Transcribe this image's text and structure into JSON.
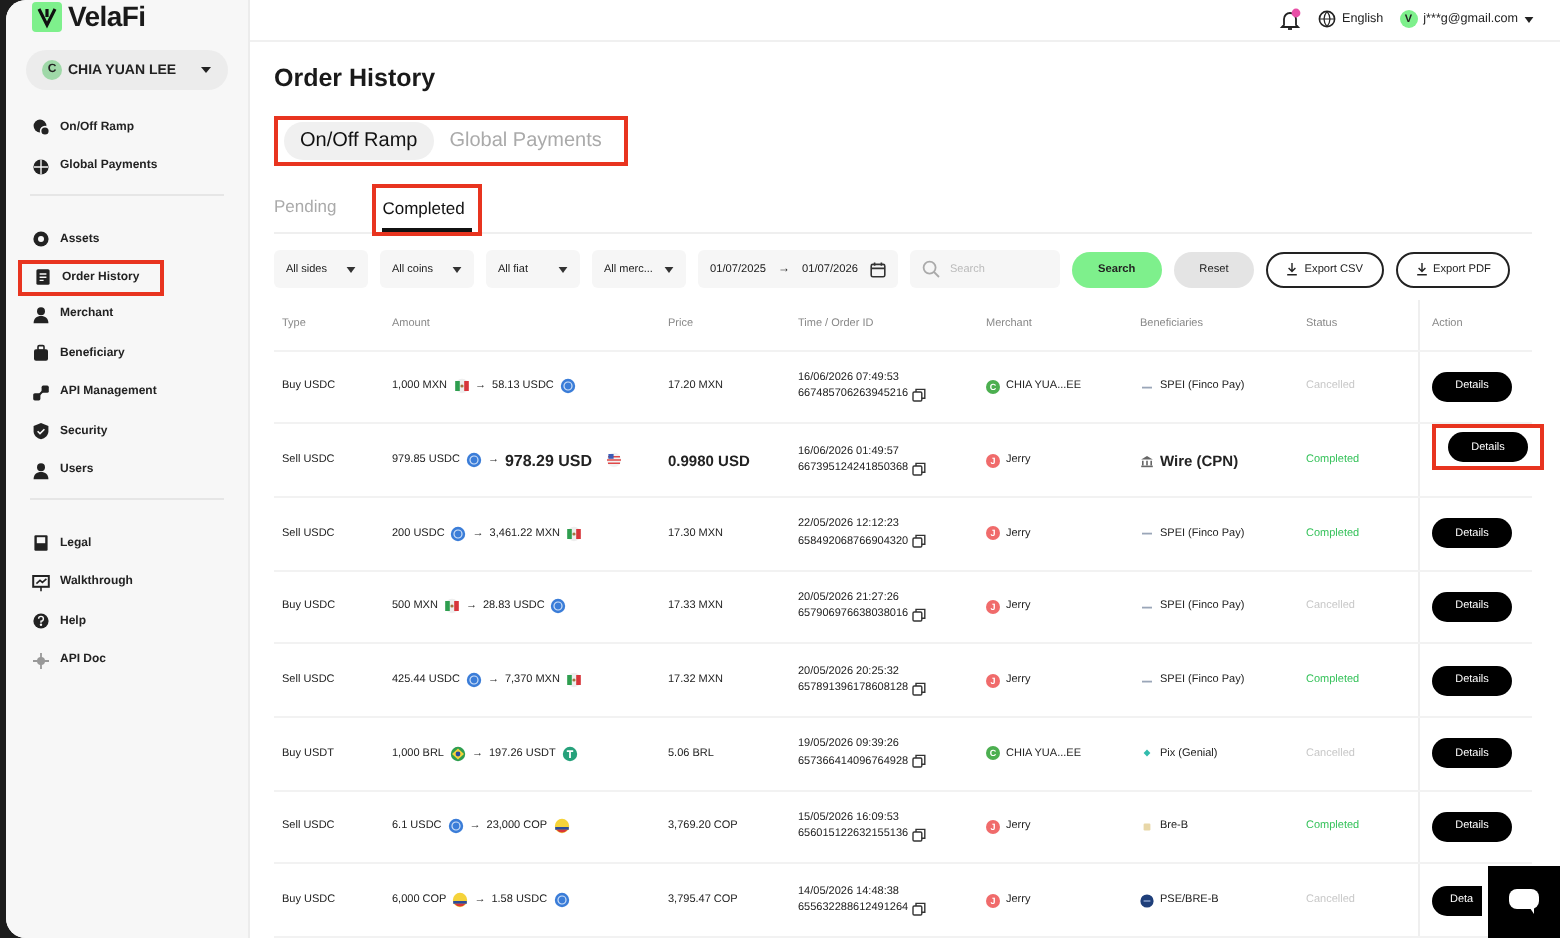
{
  "brand": {
    "name": "VelaFi"
  },
  "account": {
    "avatar": "C",
    "name": "CHIA YUAN LEE"
  },
  "sidebar": {
    "groups": [
      [
        {
          "label": "On/Off Ramp",
          "highlighted": false
        },
        {
          "label": "Global Payments",
          "highlighted": false
        }
      ],
      [
        {
          "label": "Assets",
          "highlighted": false
        },
        {
          "label": "Order History",
          "highlighted": true
        },
        {
          "label": "Merchant",
          "highlighted": false
        },
        {
          "label": "Beneficiary",
          "highlighted": false
        },
        {
          "label": "API Management",
          "highlighted": false
        },
        {
          "label": "Security",
          "highlighted": false
        },
        {
          "label": "Users",
          "highlighted": false
        }
      ],
      [
        {
          "label": "Legal",
          "highlighted": false
        },
        {
          "label": "Walkthrough",
          "highlighted": false
        },
        {
          "label": "Help",
          "highlighted": false
        },
        {
          "label": "API Doc",
          "highlighted": false
        }
      ]
    ]
  },
  "topbar": {
    "language": "English",
    "user_avatar": "V",
    "user_email": "j***g@gmail.com"
  },
  "page_title": "Order History",
  "ramp_tabs": {
    "highlighted": true,
    "items": [
      {
        "label": "On/Off Ramp",
        "selected": true
      },
      {
        "label": "Global Payments",
        "selected": false
      }
    ]
  },
  "status_tabs": [
    {
      "label": "Pending",
      "selected": false,
      "highlighted": false
    },
    {
      "label": "Completed",
      "selected": true,
      "highlighted": true
    }
  ],
  "filters": {
    "dropdowns": [
      "All sides",
      "All coins",
      "All fiat",
      "All merc..."
    ],
    "date_from": "01/07/2025",
    "date_arrow": "→",
    "date_to": "01/07/2026",
    "search_placeholder": "Search",
    "buttons": [
      {
        "label": "Search",
        "kind": "primary"
      },
      {
        "label": "Reset",
        "kind": "secondary"
      },
      {
        "label": "Export CSV",
        "kind": "export"
      },
      {
        "label": "Export PDF",
        "kind": "export"
      }
    ]
  },
  "table": {
    "columns": [
      "Type",
      "Amount",
      "Price",
      "Time / Order ID",
      "Merchant",
      "Beneficiaries",
      "Status",
      "Action"
    ],
    "rows": [
      {
        "type": "Buy USDC",
        "from": {
          "text": "1,000 MXN",
          "kind": "mx"
        },
        "arrow": "→",
        "to": {
          "text": "58.13 USDC",
          "kind": "usdc"
        },
        "emphasis": false,
        "price": "17.20 MXN",
        "time": "16/06/2026 07:49:53",
        "order_id": "667485706263945216",
        "merchant": {
          "avatar": "C",
          "name": "CHIA YUA...EE",
          "color": "#4caf50"
        },
        "beneficiary": {
          "text": "SPEI (Finco Pay)",
          "kind": "spei"
        },
        "status": {
          "text": "Cancelled",
          "kind": "cancelled"
        },
        "action": "Details",
        "highlighted": false
      },
      {
        "type": "Sell USDC",
        "from": {
          "text": "979.85 USDC",
          "kind": "usdc"
        },
        "arrow": "→",
        "to": {
          "text": "978.29 USD",
          "kind": "us"
        },
        "emphasis": true,
        "price": "0.9980 USD",
        "time": "16/06/2026 01:49:57",
        "order_id": "667395124241850368",
        "merchant": {
          "avatar": "J",
          "name": "Jerry",
          "color": "#f06b6b"
        },
        "beneficiary": {
          "text": "Wire (CPN)",
          "kind": "bank"
        },
        "status": {
          "text": "Completed",
          "kind": "completed"
        },
        "action": "Details",
        "highlighted": true
      },
      {
        "type": "Sell USDC",
        "from": {
          "text": "200 USDC",
          "kind": "usdc"
        },
        "arrow": "→",
        "to": {
          "text": "3,461.22 MXN",
          "kind": "mx"
        },
        "emphasis": false,
        "price": "17.30 MXN",
        "time": "22/05/2026 12:12:23",
        "order_id": "658492068766904320",
        "merchant": {
          "avatar": "J",
          "name": "Jerry",
          "color": "#f06b6b"
        },
        "beneficiary": {
          "text": "SPEI (Finco Pay)",
          "kind": "spei"
        },
        "status": {
          "text": "Completed",
          "kind": "completed"
        },
        "action": "Details",
        "highlighted": false
      },
      {
        "type": "Buy USDC",
        "from": {
          "text": "500 MXN",
          "kind": "mx"
        },
        "arrow": "→",
        "to": {
          "text": "28.83 USDC",
          "kind": "usdc"
        },
        "emphasis": false,
        "price": "17.33 MXN",
        "time": "20/05/2026 21:27:26",
        "order_id": "657906976638038016",
        "merchant": {
          "avatar": "J",
          "name": "Jerry",
          "color": "#f06b6b"
        },
        "beneficiary": {
          "text": "SPEI (Finco Pay)",
          "kind": "spei"
        },
        "status": {
          "text": "Cancelled",
          "kind": "cancelled"
        },
        "action": "Details",
        "highlighted": false
      },
      {
        "type": "Sell USDC",
        "from": {
          "text": "425.44 USDC",
          "kind": "usdc"
        },
        "arrow": "→",
        "to": {
          "text": "7,370 MXN",
          "kind": "mx"
        },
        "emphasis": false,
        "price": "17.32 MXN",
        "time": "20/05/2026 20:25:32",
        "order_id": "657891396178608128",
        "merchant": {
          "avatar": "J",
          "name": "Jerry",
          "color": "#f06b6b"
        },
        "beneficiary": {
          "text": "SPEI (Finco Pay)",
          "kind": "spei"
        },
        "status": {
          "text": "Completed",
          "kind": "completed"
        },
        "action": "Details",
        "highlighted": false
      },
      {
        "type": "Buy USDT",
        "from": {
          "text": "1,000 BRL",
          "kind": "br"
        },
        "arrow": "→",
        "to": {
          "text": "197.26 USDT",
          "kind": "usdt"
        },
        "emphasis": false,
        "price": "5.06 BRL",
        "time": "19/05/2026 09:39:26",
        "order_id": "657366414096764928",
        "merchant": {
          "avatar": "C",
          "name": "CHIA YUA...EE",
          "color": "#4caf50"
        },
        "beneficiary": {
          "text": "Pix (Genial)",
          "kind": "pix"
        },
        "status": {
          "text": "Cancelled",
          "kind": "cancelled"
        },
        "action": "Details",
        "highlighted": false
      },
      {
        "type": "Sell USDC",
        "from": {
          "text": "6.1 USDC",
          "kind": "usdc"
        },
        "arrow": "→",
        "to": {
          "text": "23,000 COP",
          "kind": "co"
        },
        "emphasis": false,
        "price": "3,769.20 COP",
        "time": "15/05/2026 16:09:53",
        "order_id": "656015122632155136",
        "merchant": {
          "avatar": "J",
          "name": "Jerry",
          "color": "#f06b6b"
        },
        "beneficiary": {
          "text": "Bre-B",
          "kind": "breb"
        },
        "status": {
          "text": "Completed",
          "kind": "completed"
        },
        "action": "Details",
        "highlighted": false
      },
      {
        "type": "Buy USDC",
        "from": {
          "text": "6,000 COP",
          "kind": "co"
        },
        "arrow": "→",
        "to": {
          "text": "1.58 USDC",
          "kind": "usdc"
        },
        "emphasis": false,
        "price": "3,795.47 COP",
        "time": "14/05/2026 14:48:38",
        "order_id": "655632288612491264",
        "merchant": {
          "avatar": "J",
          "name": "Jerry",
          "color": "#f06b6b"
        },
        "beneficiary": {
          "text": "PSE/BRE-B",
          "kind": "pse"
        },
        "status": {
          "text": "Cancelled",
          "kind": "cancelled"
        },
        "action": "Deta",
        "highlighted": false
      }
    ]
  },
  "chat_widget": true
}
